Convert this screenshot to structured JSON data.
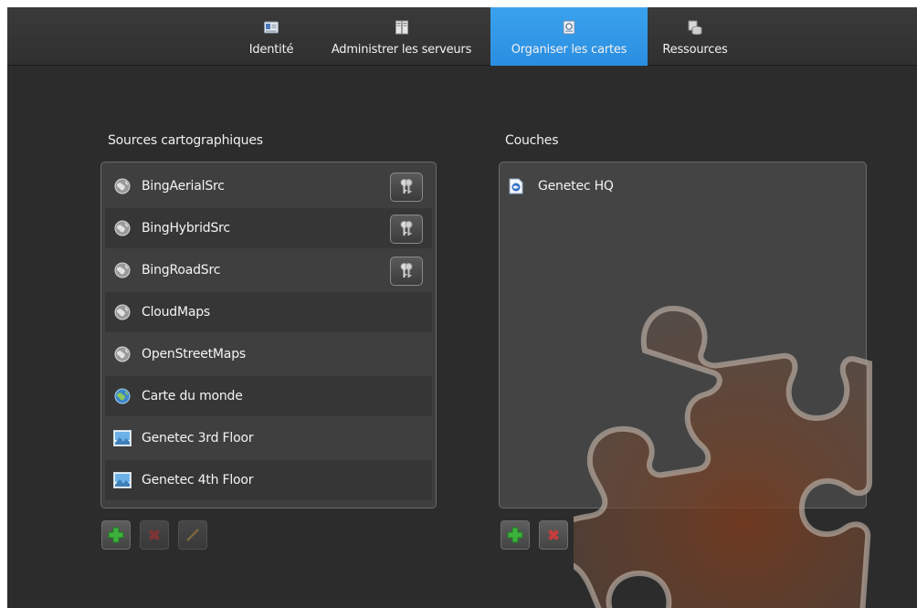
{
  "tabs": [
    {
      "label": "Identité",
      "icon": "id-card-icon",
      "active": false
    },
    {
      "label": "Administrer les serveurs",
      "icon": "server-icon",
      "active": false
    },
    {
      "label": "Organiser les cartes",
      "icon": "map-icon",
      "active": true
    },
    {
      "label": "Ressources",
      "icon": "database-icon",
      "active": false
    }
  ],
  "sources": {
    "title": "Sources cartographiques",
    "items": [
      {
        "label": "BingAerialSrc",
        "icon": "globe-gray-icon",
        "has_key": true
      },
      {
        "label": "BingHybridSrc",
        "icon": "globe-gray-icon",
        "has_key": true
      },
      {
        "label": "BingRoadSrc",
        "icon": "globe-gray-icon",
        "has_key": true
      },
      {
        "label": "CloudMaps",
        "icon": "globe-gray-icon",
        "has_key": false
      },
      {
        "label": "OpenStreetMaps",
        "icon": "globe-gray-icon",
        "has_key": false
      },
      {
        "label": "Carte du monde",
        "icon": "globe-color-icon",
        "has_key": false
      },
      {
        "label": "Genetec 3rd Floor",
        "icon": "image-icon",
        "has_key": false
      },
      {
        "label": "Genetec 4th Floor",
        "icon": "image-icon",
        "has_key": false
      }
    ]
  },
  "layers": {
    "title": "Couches",
    "items": [
      {
        "label": "Genetec HQ",
        "icon": "layer-document-icon"
      }
    ]
  },
  "colors": {
    "accent": "#2a8ee0",
    "background": "#2c2c2c",
    "add_green": "#3cb03c",
    "delete_red": "#c43c3c"
  }
}
